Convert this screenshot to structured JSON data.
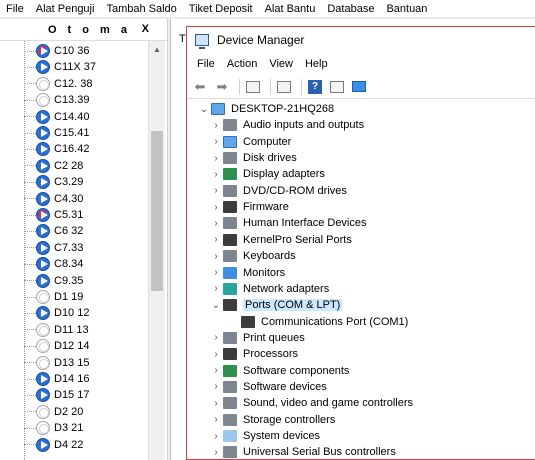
{
  "menubar": [
    "File",
    "Alat Penguji",
    "Tambah Saldo",
    "Tiket Deposit",
    "Alat Bantu",
    "Database",
    "Bantuan"
  ],
  "left_panel": {
    "title": "O t o m a",
    "close": "X",
    "items": [
      {
        "label": "C10 36",
        "state": "warn"
      },
      {
        "label": "C11X 37",
        "state": "on"
      },
      {
        "label": "C12. 38",
        "state": "off"
      },
      {
        "label": "C13.39",
        "state": "off"
      },
      {
        "label": "C14.40",
        "state": "on"
      },
      {
        "label": "C15.41",
        "state": "on"
      },
      {
        "label": "C16.42",
        "state": "on"
      },
      {
        "label": "C2 28",
        "state": "on"
      },
      {
        "label": "C3.29",
        "state": "on"
      },
      {
        "label": "C4.30",
        "state": "on"
      },
      {
        "label": "C5.31",
        "state": "warn"
      },
      {
        "label": "C6 32",
        "state": "on"
      },
      {
        "label": "C7.33",
        "state": "on"
      },
      {
        "label": "C8.34",
        "state": "on"
      },
      {
        "label": "C9.35",
        "state": "on"
      },
      {
        "label": "D1 19",
        "state": "off"
      },
      {
        "label": "D10 12",
        "state": "on"
      },
      {
        "label": "D11 13",
        "state": "off"
      },
      {
        "label": "D12 14",
        "state": "off"
      },
      {
        "label": "D13 15",
        "state": "off"
      },
      {
        "label": "D14 16",
        "state": "on"
      },
      {
        "label": "D15 17",
        "state": "on"
      },
      {
        "label": "D2 20",
        "state": "off"
      },
      {
        "label": "D3 21",
        "state": "off"
      },
      {
        "label": "D4 22",
        "state": "on"
      }
    ]
  },
  "background_window": {
    "title_fragment": "T"
  },
  "device_manager": {
    "title": "Device Manager",
    "menu": [
      "File",
      "Action",
      "View",
      "Help"
    ],
    "root": "DESKTOP-21HQ268",
    "categories": [
      {
        "label": "Audio inputs and outputs",
        "expanded": false,
        "icon": "speaker-icon",
        "color": "gray"
      },
      {
        "label": "Computer",
        "expanded": false,
        "icon": "computer-icon",
        "color": "pc"
      },
      {
        "label": "Disk drives",
        "expanded": false,
        "icon": "disk-drive-icon",
        "color": "gray"
      },
      {
        "label": "Display adapters",
        "expanded": false,
        "icon": "display-adapter-icon",
        "color": "green"
      },
      {
        "label": "DVD/CD-ROM drives",
        "expanded": false,
        "icon": "dvd-icon",
        "color": "gray"
      },
      {
        "label": "Firmware",
        "expanded": false,
        "icon": "firmware-icon",
        "color": "dark"
      },
      {
        "label": "Human Interface Devices",
        "expanded": false,
        "icon": "hid-icon",
        "color": "gray"
      },
      {
        "label": "KernelPro Serial Ports",
        "expanded": false,
        "icon": "serial-port-icon",
        "color": "dark"
      },
      {
        "label": "Keyboards",
        "expanded": false,
        "icon": "keyboard-icon",
        "color": "gray"
      },
      {
        "label": "Monitors",
        "expanded": false,
        "icon": "monitor-icon",
        "color": "blue"
      },
      {
        "label": "Network adapters",
        "expanded": false,
        "icon": "network-icon",
        "color": "teal"
      },
      {
        "label": "Ports (COM & LPT)",
        "expanded": true,
        "icon": "port-icon",
        "color": "dark",
        "children": [
          {
            "label": "Communications Port (COM1)",
            "icon": "com-port-icon",
            "color": "dark"
          }
        ]
      },
      {
        "label": "Print queues",
        "expanded": false,
        "icon": "printer-icon",
        "color": "gray"
      },
      {
        "label": "Processors",
        "expanded": false,
        "icon": "processor-icon",
        "color": "dark"
      },
      {
        "label": "Software components",
        "expanded": false,
        "icon": "software-component-icon",
        "color": "green"
      },
      {
        "label": "Software devices",
        "expanded": false,
        "icon": "software-device-icon",
        "color": "gray"
      },
      {
        "label": "Sound, video and game controllers",
        "expanded": false,
        "icon": "sound-icon",
        "color": "gray"
      },
      {
        "label": "Storage controllers",
        "expanded": false,
        "icon": "storage-icon",
        "color": "gray"
      },
      {
        "label": "System devices",
        "expanded": false,
        "icon": "system-device-icon",
        "color": "lb"
      },
      {
        "label": "Universal Serial Bus controllers",
        "expanded": false,
        "icon": "usb-icon",
        "color": "gray"
      }
    ]
  }
}
